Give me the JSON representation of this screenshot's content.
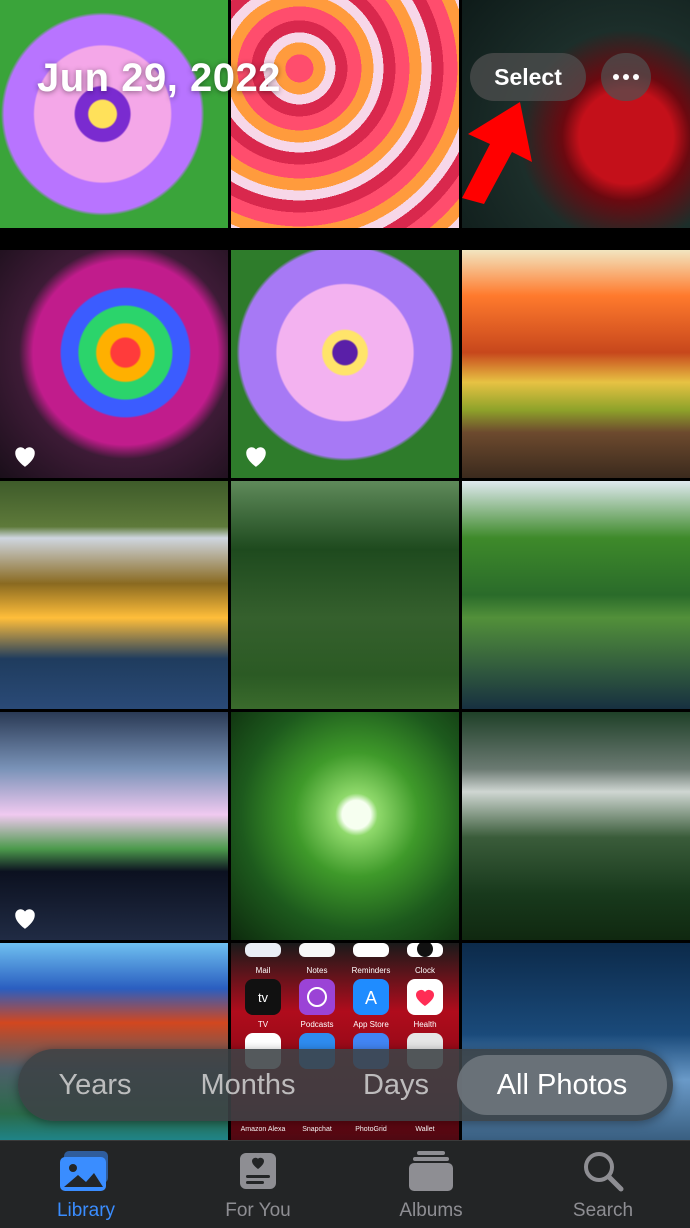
{
  "header": {
    "date_title": "Jun 29, 2022",
    "select_label": "Select"
  },
  "grid": {
    "favorites": [
      true,
      false,
      false,
      true,
      true,
      false,
      false,
      false,
      false,
      true,
      false,
      false,
      false,
      false,
      false
    ]
  },
  "tile_icons": {
    "mail": "Mail",
    "notes": "Notes",
    "reminders": "Reminders",
    "clock": "Clock",
    "tv": "TV",
    "podcasts": "Podcasts",
    "appstore": "App Store",
    "health": "Health",
    "amazon": "Amazon Alexa",
    "snapchat": "Snapchat",
    "photogrid": "PhotoGrid",
    "wallet": "Wallet"
  },
  "segmented": {
    "items": [
      "Years",
      "Months",
      "Days",
      "All Photos"
    ],
    "selected": "All Photos"
  },
  "tabs": [
    {
      "label": "Library",
      "icon": "photos-stack-icon",
      "active": true
    },
    {
      "label": "For You",
      "icon": "for-you-icon",
      "active": false
    },
    {
      "label": "Albums",
      "icon": "albums-icon",
      "active": false
    },
    {
      "label": "Search",
      "icon": "search-icon",
      "active": false
    }
  ],
  "colors": {
    "accent": "#3a8dff",
    "arrow": "#ff0000",
    "tabbar_bg": "#232526"
  }
}
